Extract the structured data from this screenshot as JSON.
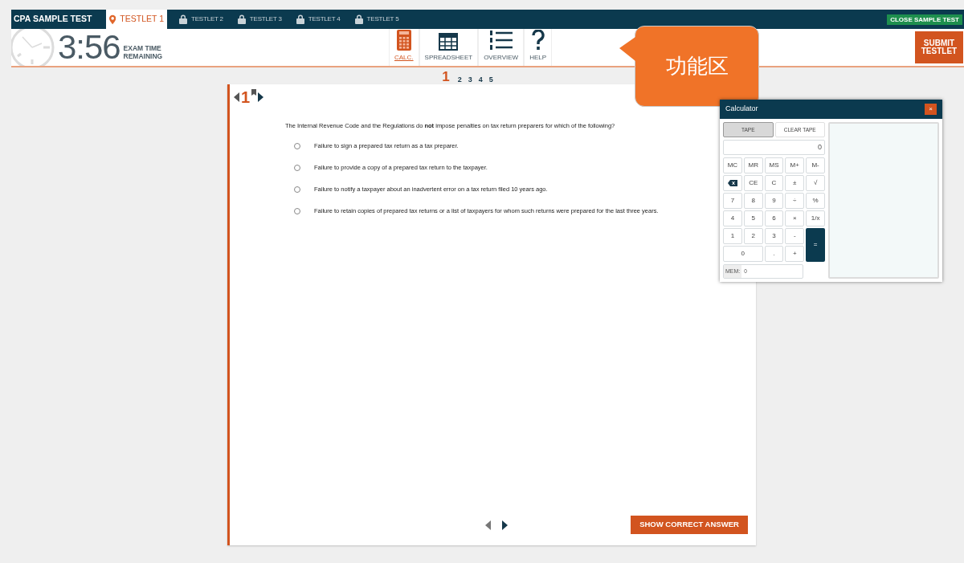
{
  "top_bar": {
    "title": "CPA SAMPLE TEST",
    "close_button": "CLOSE SAMPLE TEST"
  },
  "tabs": [
    {
      "label": "TESTLET 1",
      "selected": true,
      "locked": false
    },
    {
      "label": "TESTLET 2",
      "selected": false,
      "locked": true
    },
    {
      "label": "TESTLET 3",
      "selected": false,
      "locked": true
    },
    {
      "label": "TESTLET 4",
      "selected": false,
      "locked": true
    },
    {
      "label": "TESTLET 5",
      "selected": false,
      "locked": true
    }
  ],
  "timer": {
    "time": "3:56",
    "caption": "EXAM TIME REMAINING"
  },
  "tools": [
    {
      "label": "CALC.",
      "kind": "calculator",
      "selected": true
    },
    {
      "label": "SPREADSHEET",
      "kind": "spreadsheet",
      "selected": false
    },
    {
      "label": "OVERVIEW",
      "kind": "overview",
      "selected": false
    },
    {
      "label": "HELP",
      "kind": "help",
      "selected": false
    }
  ],
  "submit_button": "SUBMIT TESTLET",
  "question_nav": [
    {
      "label": "1",
      "selected": true
    },
    {
      "label": "2",
      "selected": false
    },
    {
      "label": "3",
      "selected": false
    },
    {
      "label": "4",
      "selected": false
    },
    {
      "label": "5",
      "selected": false
    }
  ],
  "question": {
    "number": "1",
    "text": "The Internal Revenue Code and the Regulations do **not** impose penalties on tax return preparers for which of the following?",
    "options": [
      {
        "text": "Failure to sign a prepared tax return as a tax preparer.",
        "selected": false
      },
      {
        "text": "Failure to provide a copy of a prepared tax return to the taxpayer.",
        "selected": false
      },
      {
        "text": "Failure to notify a taxpayer about an inadvertent error on a tax return filed 10 years ago.",
        "selected": false
      },
      {
        "text": "Failure to retain copies of prepared tax returns or a list of taxpayers for whom such returns were prepared for the last three years.",
        "selected": false
      }
    ],
    "show_answer_button": "SHOW CORRECT ANSWER"
  },
  "callout": "功能区",
  "calculator": {
    "title": "Calculator",
    "close": "×",
    "tape_button": "TAPE",
    "clear_tape_button": "CLEAR TAPE",
    "display": "0",
    "keys": [
      {
        "label": "MC",
        "kind": "key"
      },
      {
        "label": "MR",
        "kind": "key"
      },
      {
        "label": "MS",
        "kind": "key"
      },
      {
        "label": "M+",
        "kind": "key"
      },
      {
        "label": "M-",
        "kind": "key"
      },
      {
        "kind": "backspace"
      },
      {
        "label": "CE",
        "kind": "key"
      },
      {
        "label": "C",
        "kind": "key"
      },
      {
        "label": "±",
        "kind": "key"
      },
      {
        "label": "√",
        "kind": "key"
      },
      {
        "label": "7",
        "kind": "key"
      },
      {
        "label": "8",
        "kind": "key"
      },
      {
        "label": "9",
        "kind": "key"
      },
      {
        "label": "÷",
        "kind": "key"
      },
      {
        "label": "%",
        "kind": "key"
      },
      {
        "label": "4",
        "kind": "key"
      },
      {
        "label": "5",
        "kind": "key"
      },
      {
        "label": "6",
        "kind": "key"
      },
      {
        "label": "×",
        "kind": "key"
      },
      {
        "label": "1/x",
        "kind": "key"
      },
      {
        "label": "1",
        "kind": "key"
      },
      {
        "label": "2",
        "kind": "key"
      },
      {
        "label": "3",
        "kind": "key"
      },
      {
        "label": "-",
        "kind": "key"
      },
      {
        "label": "=",
        "kind": "equals"
      },
      {
        "label": "0",
        "kind": "wide"
      },
      {
        "label": ".",
        "kind": "key"
      },
      {
        "label": "+",
        "kind": "key"
      }
    ],
    "mem_label": "MEM:",
    "mem_value": "0"
  }
}
